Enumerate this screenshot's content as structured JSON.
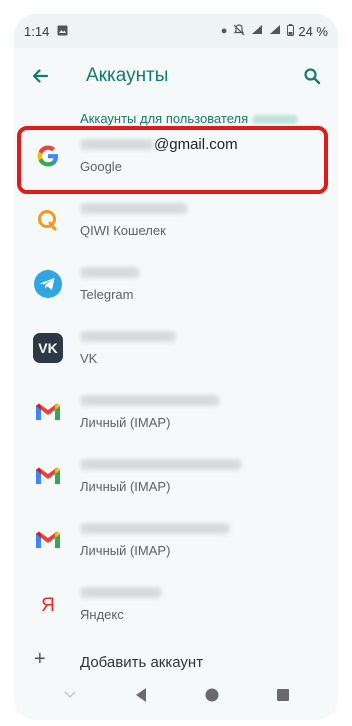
{
  "status_bar": {
    "time": "1:14",
    "battery": "24 %"
  },
  "app_bar": {
    "title": "Аккаунты"
  },
  "section_header": "Аккаунты для пользователя",
  "accounts": [
    {
      "name": "@gmail.com",
      "type": "Google",
      "icon": "google-icon"
    },
    {
      "name": "",
      "type": "QIWI Кошелек",
      "icon": "qiwi-icon"
    },
    {
      "name": "",
      "type": "Telegram",
      "icon": "telegram-icon"
    },
    {
      "name": "",
      "type": "VK",
      "icon": "vk-icon"
    },
    {
      "name": "",
      "type": "Личный (IMAP)",
      "icon": "gmail-icon"
    },
    {
      "name": "",
      "type": "Личный (IMAP)",
      "icon": "gmail-icon"
    },
    {
      "name": "",
      "type": "Личный (IMAP)",
      "icon": "gmail-icon"
    },
    {
      "name": "",
      "type": "Яндекс",
      "icon": "yandex-icon"
    }
  ],
  "add_account": "Добавить аккаунт",
  "colors": {
    "accent": "#127a6e",
    "highlight": "#e01b1b"
  }
}
